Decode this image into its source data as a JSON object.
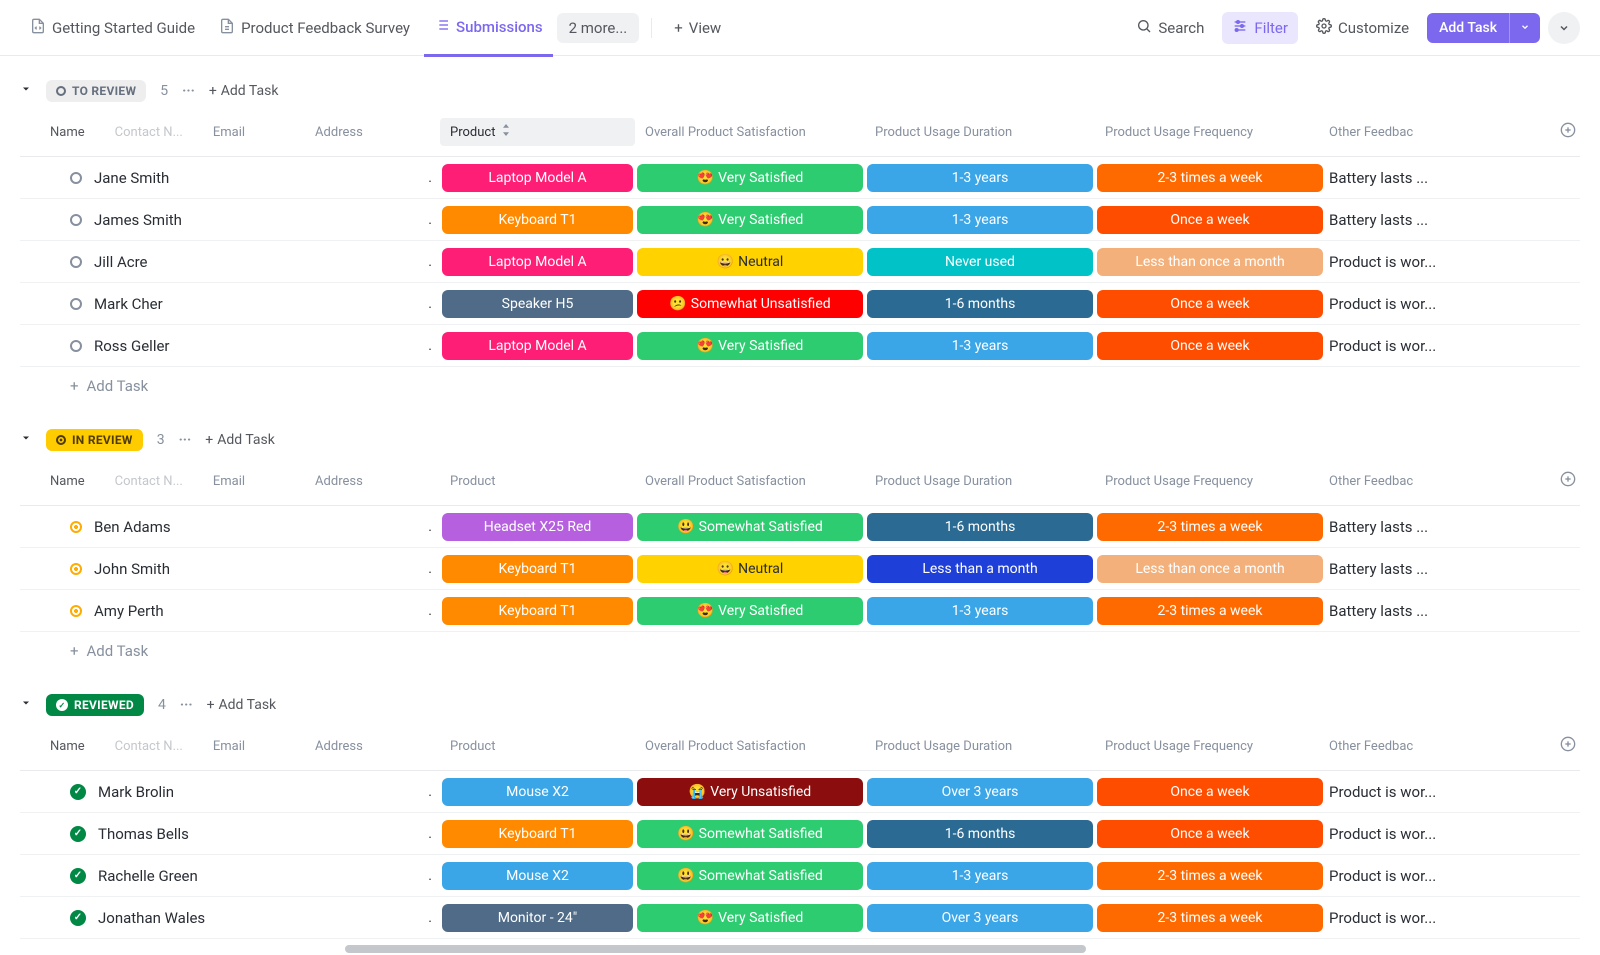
{
  "nav": {
    "tabs": [
      {
        "label": "Getting Started Guide",
        "icon": "doc"
      },
      {
        "label": "Product Feedback Survey",
        "icon": "doc"
      },
      {
        "label": "Submissions",
        "icon": "list",
        "active": true
      }
    ],
    "more": "2 more...",
    "view": "View",
    "search": "Search",
    "filter": "Filter",
    "customize": "Customize",
    "add_task": "Add Task"
  },
  "columns": {
    "name": "Name",
    "contact": "Contact N...",
    "email": "Email",
    "address": "Address",
    "product": "Product",
    "satisfaction": "Overall Product Satisfaction",
    "duration": "Product Usage Duration",
    "frequency": "Product Usage Frequency",
    "other": "Other Feedbac"
  },
  "actions": {
    "add_task": "Add Task"
  },
  "colors": {
    "product": {
      "Laptop Model A": "#ff1e75",
      "Keyboard T1": "#ff8a00",
      "Speaker H5": "#4f6b87",
      "Headset X25 Red": "#b660e0",
      "Mouse X2": "#3aa6e8",
      "Monitor - 24\"": "#4f6b87"
    },
    "satisfaction": {
      "Very Satisfied": "#2ecc71",
      "Somewhat Satisfied": "#2ecc71",
      "Neutral": "#ffd200",
      "Somewhat Unsatisfied": "#ff0000",
      "Very Unsatisfied": "#8b0d0d"
    },
    "duration": {
      "1-3 years": "#3aa6e8",
      "Never used": "#00c2c7",
      "1-6 months": "#2a6a93",
      "Less than a month": "#1e3fd8",
      "Over 3 years": "#3aa6e8"
    },
    "frequency": {
      "2-3 times a week": "#ff6a00",
      "Once a week": "#ff4d00",
      "Less than once a month": "#f3b07a"
    },
    "status": {
      "TO REVIEW": "#87909e",
      "IN REVIEW": "#ffab00",
      "REVIEWED": "#008844"
    }
  },
  "emoji": {
    "Very Satisfied": "😍",
    "Somewhat Satisfied": "😃",
    "Neutral": "😀",
    "Somewhat Unsatisfied": "😕",
    "Very Unsatisfied": "😭"
  },
  "groups": [
    {
      "status": "TO REVIEW",
      "pill_class": "toreview",
      "icon": "circle",
      "count": 5,
      "rows": [
        {
          "name": "Jane Smith",
          "addr": ".",
          "product": "Laptop Model A",
          "satisfaction": "Very Satisfied",
          "duration": "1-3 years",
          "frequency": "2-3 times a week",
          "other": "Battery lasts ..."
        },
        {
          "name": "James Smith",
          "addr": ".",
          "product": "Keyboard T1",
          "satisfaction": "Very Satisfied",
          "duration": "1-3 years",
          "frequency": "Once a week",
          "other": "Battery lasts ..."
        },
        {
          "name": "Jill Acre",
          "addr": ".",
          "product": "Laptop Model A",
          "satisfaction": "Neutral",
          "duration": "Never used",
          "frequency": "Less than once a month",
          "other": "Product is wor..."
        },
        {
          "name": "Mark Cher",
          "addr": ".",
          "product": "Speaker H5",
          "satisfaction": "Somewhat Unsatisfied",
          "duration": "1-6 months",
          "frequency": "Once a week",
          "other": "Product is wor..."
        },
        {
          "name": "Ross Geller",
          "addr": ".",
          "product": "Laptop Model A",
          "satisfaction": "Very Satisfied",
          "duration": "1-3 years",
          "frequency": "Once a week",
          "other": "Product is wor..."
        }
      ]
    },
    {
      "status": "IN REVIEW",
      "pill_class": "inreview",
      "icon": "circle-dot",
      "count": 3,
      "rows": [
        {
          "name": "Ben Adams",
          "addr": ".",
          "product": "Headset X25 Red",
          "satisfaction": "Somewhat Satisfied",
          "duration": "1-6 months",
          "frequency": "2-3 times a week",
          "other": "Battery lasts ..."
        },
        {
          "name": "John Smith",
          "addr": ".",
          "product": "Keyboard T1",
          "satisfaction": "Neutral",
          "duration": "Less than a month",
          "frequency": "Less than once a month",
          "other": "Battery lasts ..."
        },
        {
          "name": "Amy Perth",
          "addr": ".",
          "product": "Keyboard T1",
          "satisfaction": "Very Satisfied",
          "duration": "1-3 years",
          "frequency": "2-3 times a week",
          "other": "Battery lasts ..."
        }
      ]
    },
    {
      "status": "REVIEWED",
      "pill_class": "reviewed",
      "icon": "check",
      "count": 4,
      "rows": [
        {
          "name": "Mark Brolin",
          "addr": ".",
          "product": "Mouse X2",
          "satisfaction": "Very Unsatisfied",
          "duration": "Over 3 years",
          "frequency": "Once a week",
          "other": "Product is wor..."
        },
        {
          "name": "Thomas Bells",
          "addr": ".",
          "product": "Keyboard T1",
          "satisfaction": "Somewhat Satisfied",
          "duration": "1-6 months",
          "frequency": "Once a week",
          "other": "Product is wor..."
        },
        {
          "name": "Rachelle Green",
          "addr": ".",
          "product": "Mouse X2",
          "satisfaction": "Somewhat Satisfied",
          "duration": "1-3 years",
          "frequency": "2-3 times a week",
          "other": "Product is wor..."
        },
        {
          "name": "Jonathan Wales",
          "addr": ".",
          "product": "Monitor - 24\"",
          "satisfaction": "Very Satisfied",
          "duration": "Over 3 years",
          "frequency": "2-3 times a week",
          "other": "Product is wor..."
        }
      ]
    }
  ]
}
